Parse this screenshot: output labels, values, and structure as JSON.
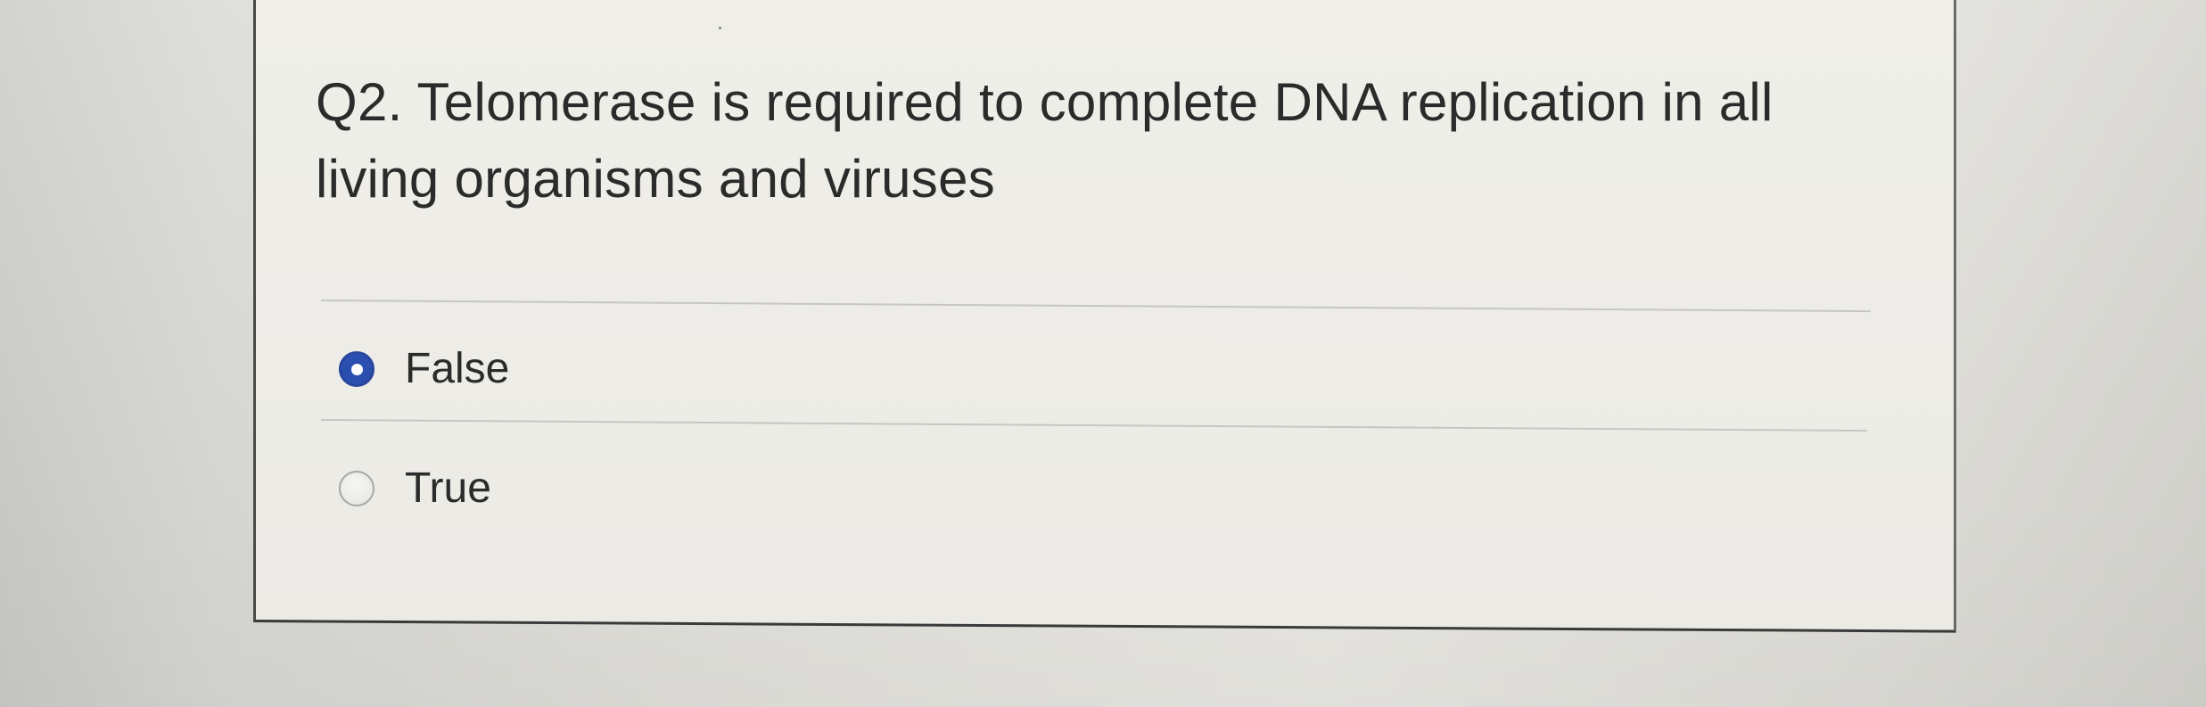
{
  "question": {
    "text": "Q2. Telomerase is required to complete DNA replication in all living organisms and viruses"
  },
  "options": [
    {
      "label": "False",
      "selected": true
    },
    {
      "label": "True",
      "selected": false
    }
  ],
  "colors": {
    "radio_selected": "#2b4fb0",
    "text": "#2b2b2b",
    "card_background": "#eeede8",
    "divider": "#c7c6c1"
  }
}
